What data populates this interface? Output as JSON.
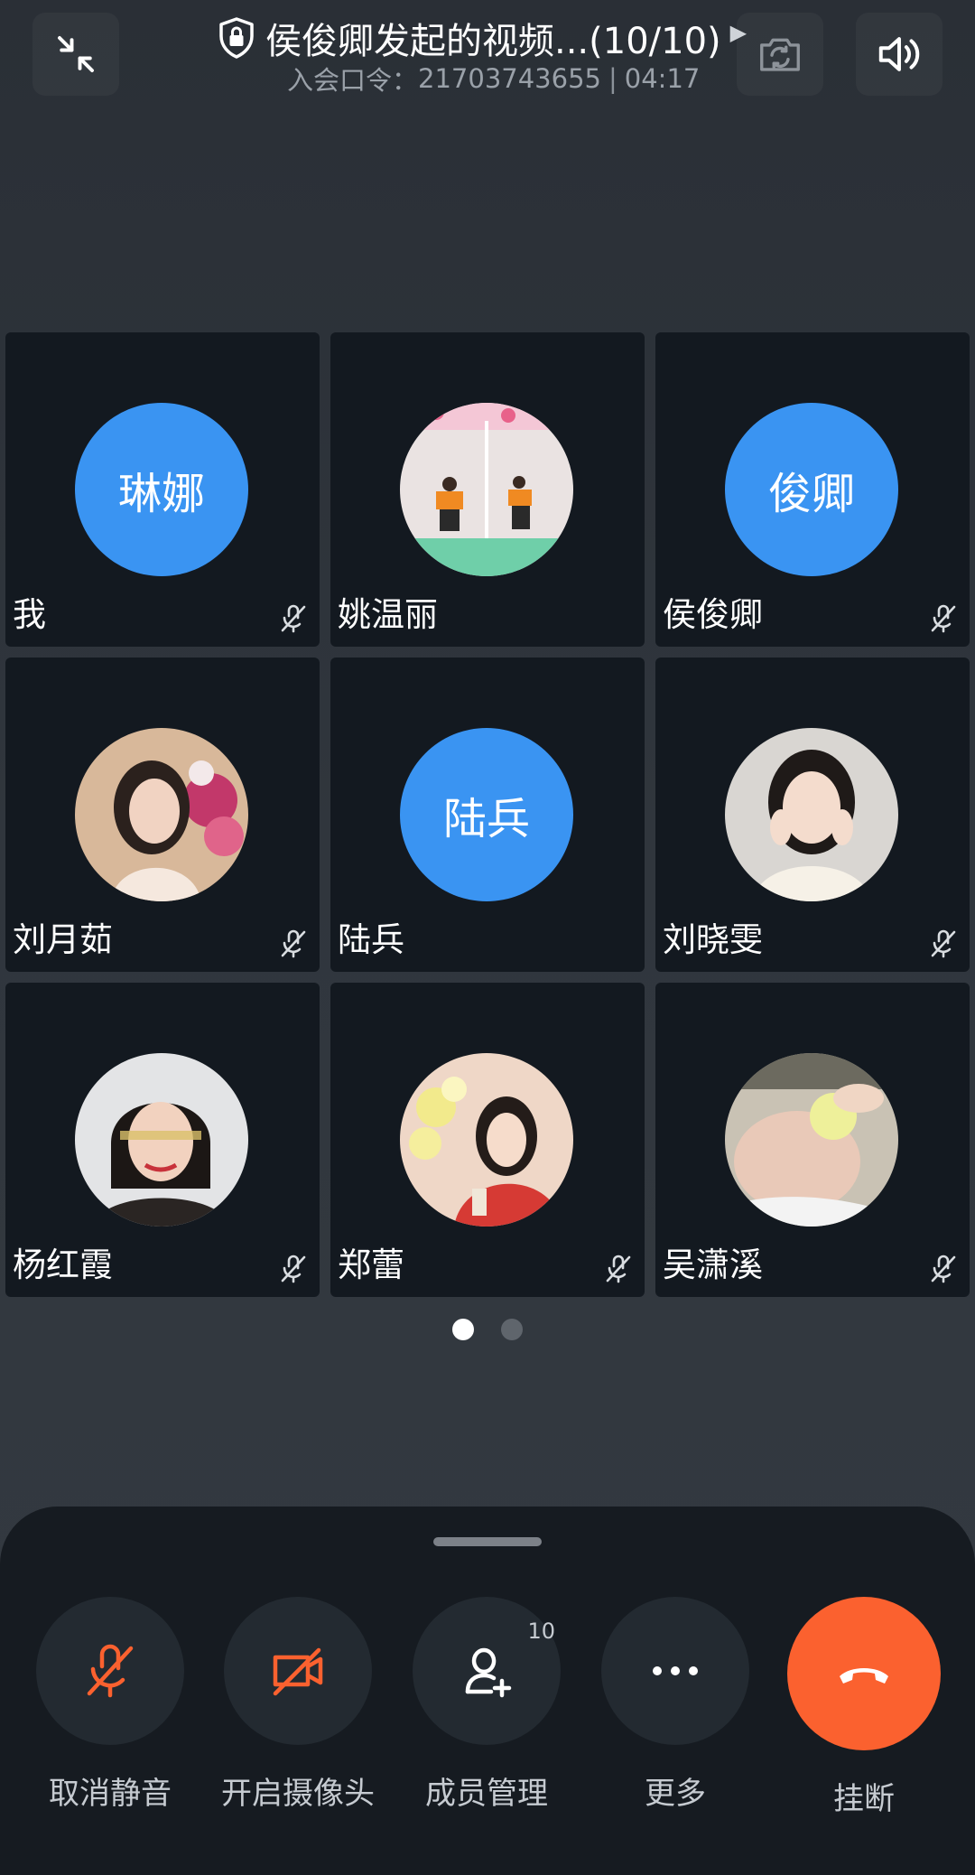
{
  "header": {
    "title": "侯俊卿发起的视频...(10/10)",
    "title_caret": "▶",
    "meeting_code_label": "入会口令：",
    "meeting_code": "21703743655",
    "separator": "|",
    "duration": "04:17",
    "icons": {
      "minimize": "collapse-arrows-icon",
      "security": "shield-lock-icon",
      "switch_camera": "switch-camera-icon",
      "speaker": "speaker-icon"
    }
  },
  "participants": [
    {
      "name": "我",
      "avatar_text": "琳娜",
      "avatar_type": "initials",
      "muted": true
    },
    {
      "name": "姚温丽",
      "avatar_type": "photo",
      "muted": false
    },
    {
      "name": "侯俊卿",
      "avatar_text": "俊卿",
      "avatar_type": "initials",
      "muted": true
    },
    {
      "name": "刘月茹",
      "avatar_type": "photo",
      "muted": true
    },
    {
      "name": "陆兵",
      "avatar_text": "陆兵",
      "avatar_type": "initials",
      "muted": false
    },
    {
      "name": "刘晓雯",
      "avatar_type": "photo",
      "muted": true
    },
    {
      "name": "杨红霞",
      "avatar_type": "photo",
      "muted": true
    },
    {
      "name": "郑蕾",
      "avatar_type": "photo",
      "muted": true
    },
    {
      "name": "吴潇溪",
      "avatar_type": "photo",
      "muted": true
    }
  ],
  "pager": {
    "pages": 2,
    "current": 1
  },
  "controls": {
    "unmute": {
      "label": "取消静音",
      "icon": "mic-off-icon"
    },
    "camera": {
      "label": "开启摄像头",
      "icon": "camera-off-icon"
    },
    "members": {
      "label": "成员管理",
      "icon": "add-member-icon",
      "badge": "10"
    },
    "more": {
      "label": "更多",
      "icon": "more-dots-icon"
    },
    "hangup": {
      "label": "挂断",
      "icon": "hang-up-icon"
    }
  },
  "colors": {
    "accent_orange": "#fb612f",
    "avatar_blue": "#3a94f2",
    "tile_bg": "#131920",
    "panel_bg": "#161b21"
  }
}
